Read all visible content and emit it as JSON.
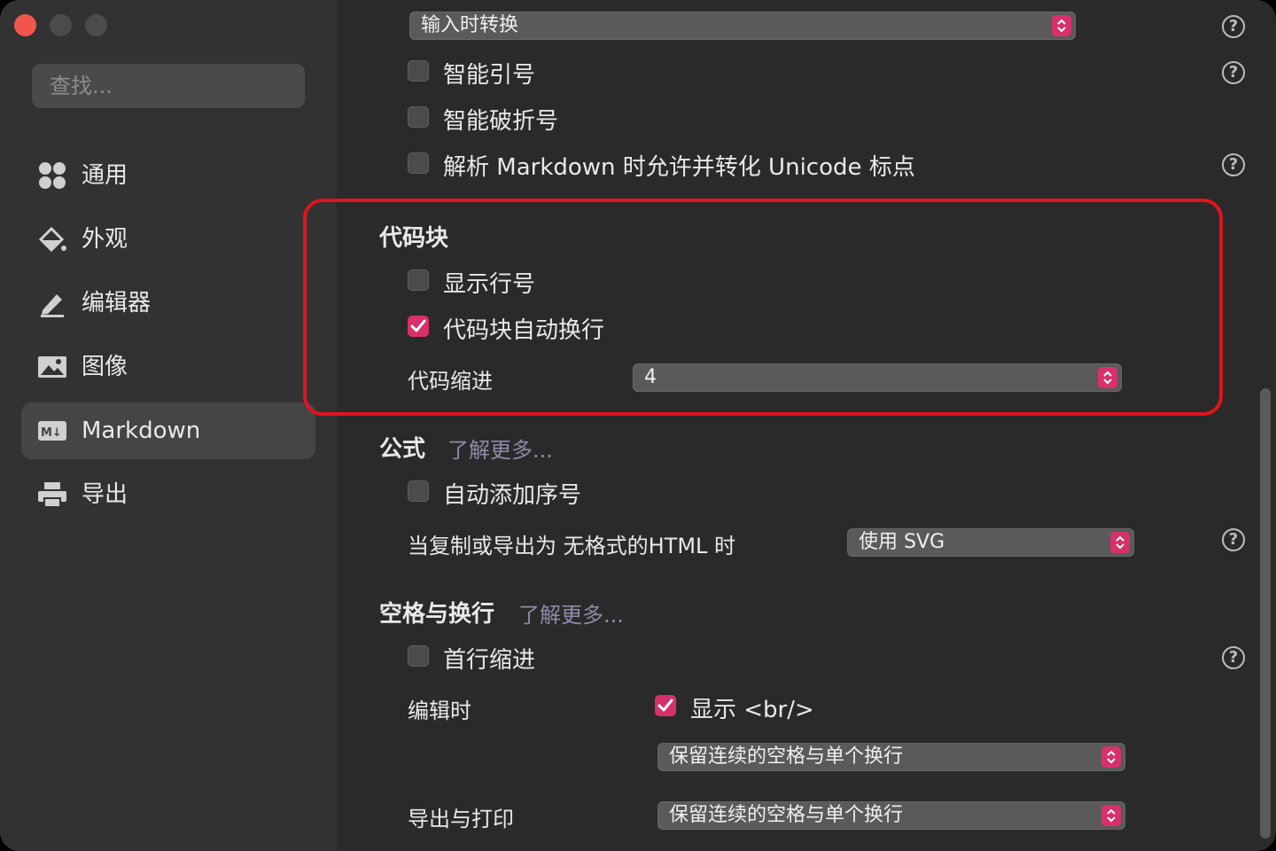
{
  "sidebar": {
    "search_placeholder": "查找...",
    "items": [
      {
        "label": "通用",
        "icon": "four-circles-icon"
      },
      {
        "label": "外观",
        "icon": "paint-bucket-icon"
      },
      {
        "label": "编辑器",
        "icon": "pen-icon"
      },
      {
        "label": "图像",
        "icon": "image-icon"
      },
      {
        "label": "Markdown",
        "icon": "markdown-icon",
        "selected": true
      },
      {
        "label": "导出",
        "icon": "printer-icon"
      }
    ]
  },
  "main": {
    "top_select_value": "输入时转换",
    "smart_quotes_label": "智能引号",
    "smart_dashes_label": "智能破折号",
    "unicode_label": "解析 Markdown 时允许并转化 Unicode 标点",
    "code_block": {
      "heading": "代码块",
      "show_line_numbers_label": "显示行号",
      "auto_wrap_label": "代码块自动换行",
      "auto_wrap_checked": true,
      "indent_label": "代码缩进",
      "indent_value": "4"
    },
    "math": {
      "heading": "公式",
      "learn_more": "了解更多...",
      "auto_numbering_label": "自动添加序号",
      "copy_export_label": "当复制或导出为 无格式的HTML 时",
      "copy_export_value": "使用 SVG"
    },
    "whitespace": {
      "heading": "空格与换行",
      "learn_more": "了解更多...",
      "first_line_indent_label": "首行缩进",
      "editing_label": "编辑时",
      "show_br_label": "显示 <br/>",
      "show_br_checked": true,
      "editing_select_value": "保留连续的空格与单个换行",
      "export_print_label": "导出与打印",
      "export_print_select_value": "保留连续的空格与单个换行"
    },
    "help_symbol": "?"
  },
  "colors": {
    "accent": "#d8306a",
    "highlight_border": "#e0141e",
    "sidebar_bg": "#323232",
    "main_bg": "#2a2a2a"
  }
}
